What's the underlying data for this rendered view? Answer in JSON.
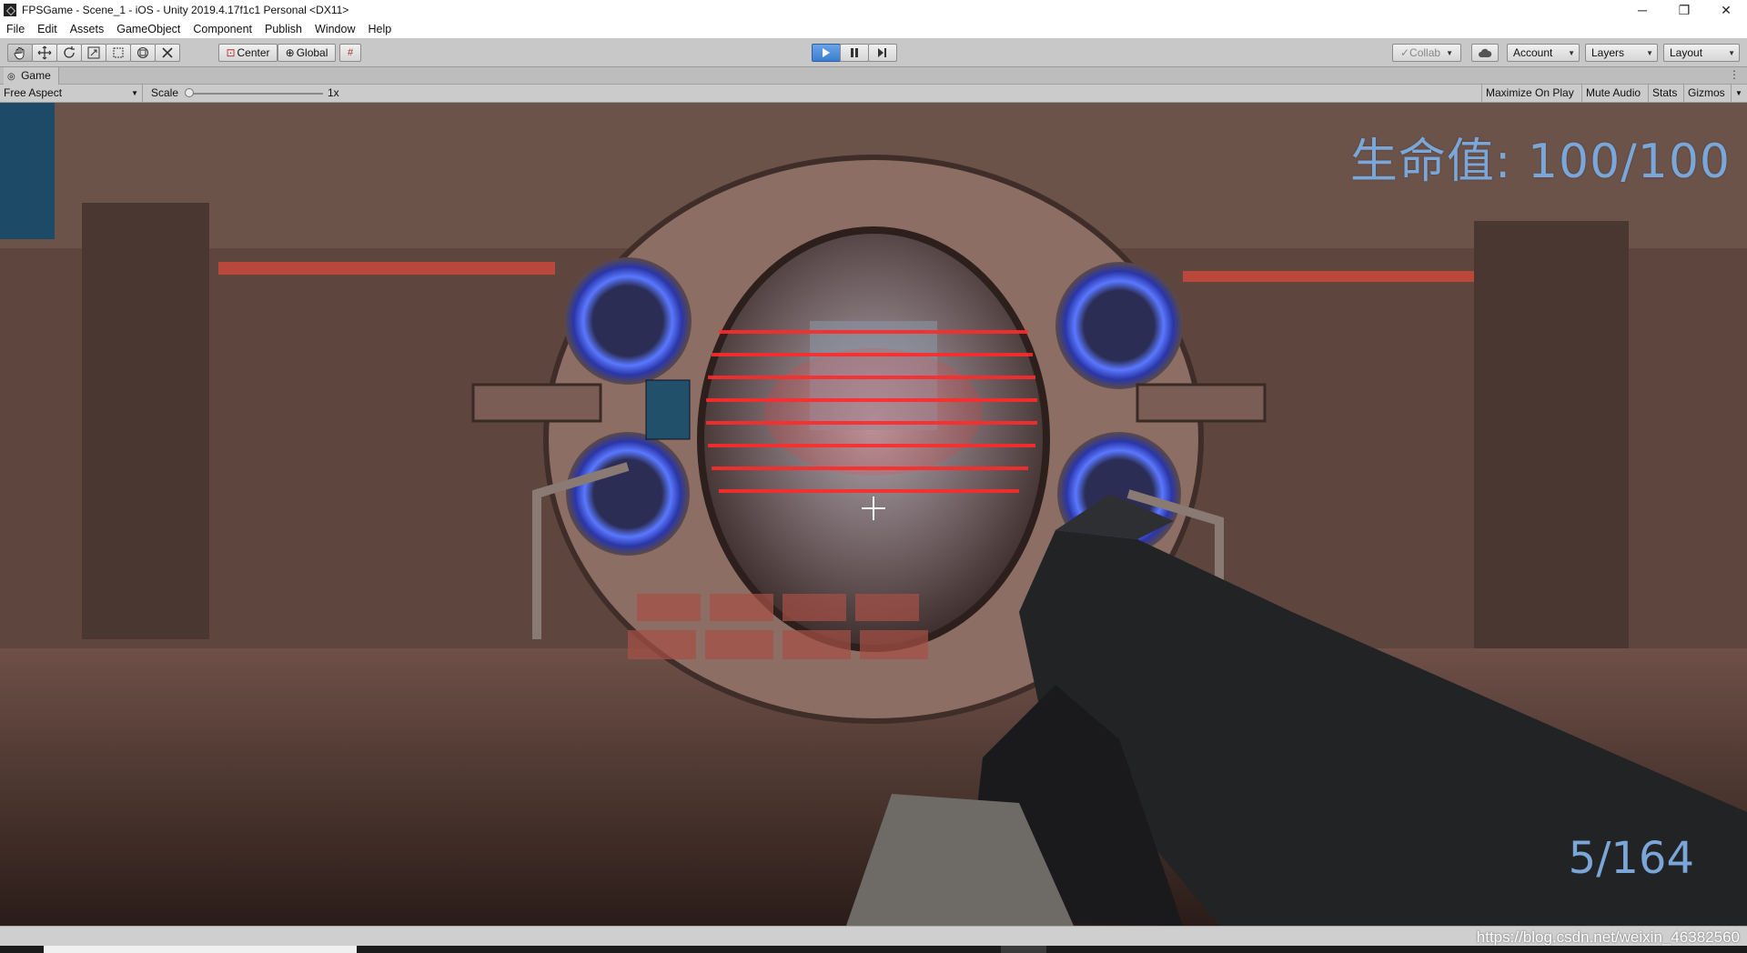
{
  "window": {
    "title": "FPSGame - Scene_1 - iOS - Unity 2019.4.17f1c1 Personal <DX11>",
    "controls": [
      "─",
      "❐",
      "✕"
    ]
  },
  "menu": [
    "File",
    "Edit",
    "Assets",
    "GameObject",
    "Component",
    "Publish",
    "Window",
    "Help"
  ],
  "toolbar": {
    "tools": [
      "hand-tool-icon",
      "move-tool-icon",
      "rotate-tool-icon",
      "scale-tool-icon",
      "rect-tool-icon",
      "transform-tool-icon",
      "custom-tool-icon"
    ],
    "pivot_label": "Center",
    "space_label": "Global",
    "play_state": "playing",
    "collab_label": "Collab",
    "account_label": "Account",
    "layers_label": "Layers",
    "layout_label": "Layout"
  },
  "panel": {
    "tab_label": "Game"
  },
  "game_toolbar": {
    "aspect": "Free Aspect",
    "scale_label": "Scale",
    "scale_value": "1x",
    "scale_fraction": 0,
    "maximize_label": "Maximize On Play",
    "mute_label": "Mute Audio",
    "stats_label": "Stats",
    "gizmos_label": "Gizmos"
  },
  "hud": {
    "health": "生命值: 100/100",
    "ammo": "5/164",
    "color": "#7aa6d8"
  },
  "watermark": "https://blog.csdn.net/weixin_46382560"
}
